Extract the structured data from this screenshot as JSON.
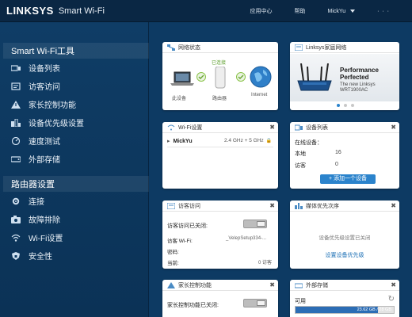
{
  "header": {
    "logo": "LINKSYS",
    "product": "Smart Wi-Fi",
    "app_center": "应用中心",
    "help": "帮助",
    "user": "MickYu",
    "more": "·  ·  ·"
  },
  "sidebar": {
    "section1": "Smart Wi-Fi工具",
    "tools": [
      {
        "label": "设备列表"
      },
      {
        "label": "访客访问"
      },
      {
        "label": "家长控制功能"
      },
      {
        "label": "设备优先级设置"
      },
      {
        "label": "速度测试"
      },
      {
        "label": "外部存储"
      }
    ],
    "section2": "路由器设置",
    "settings": [
      {
        "label": "连接"
      },
      {
        "label": "故障排除"
      },
      {
        "label": "Wi-Fi设置"
      },
      {
        "label": "安全性"
      }
    ]
  },
  "network": {
    "title": "网络状态",
    "connected": "已连接",
    "this_device": "此设备",
    "router": "路由器",
    "internet": "Internet"
  },
  "promo": {
    "title": "Linksys家庭网络",
    "headline1": "Performance",
    "headline2": "Perfected",
    "line3": "The new Linksys",
    "line4": "WRT1900AC"
  },
  "wifi": {
    "title": "Wi-Fi设置",
    "ssid": "MickYu",
    "band": "2.4 GHz + 5 GHz"
  },
  "devices": {
    "title": "设备列表",
    "online_label": "在线设备：",
    "local_label": "本地",
    "local_count": "16",
    "guest_label": "访客",
    "guest_count": "0",
    "add_button": "+ 添加一个设备"
  },
  "guest": {
    "title": "访客访问",
    "status_label": "访客访问已关闭:",
    "wifi_label": "访客 Wi-Fi:",
    "wifi_value": "_VelepSetup334-...",
    "password_label": "密码:",
    "current_label": "当前:",
    "current_value": "0 访客"
  },
  "priority": {
    "title": "媒体优先次序",
    "message": "设备优先级设置已关闭",
    "link": "设置设备优先级"
  },
  "parental": {
    "title": "家长控制功能",
    "status_label": "家长控制功能已关闭:"
  },
  "storage": {
    "title": "外部存储",
    "label": "可用",
    "usage": "23.62 GB / 28 GB",
    "used_fraction": 0.84
  }
}
